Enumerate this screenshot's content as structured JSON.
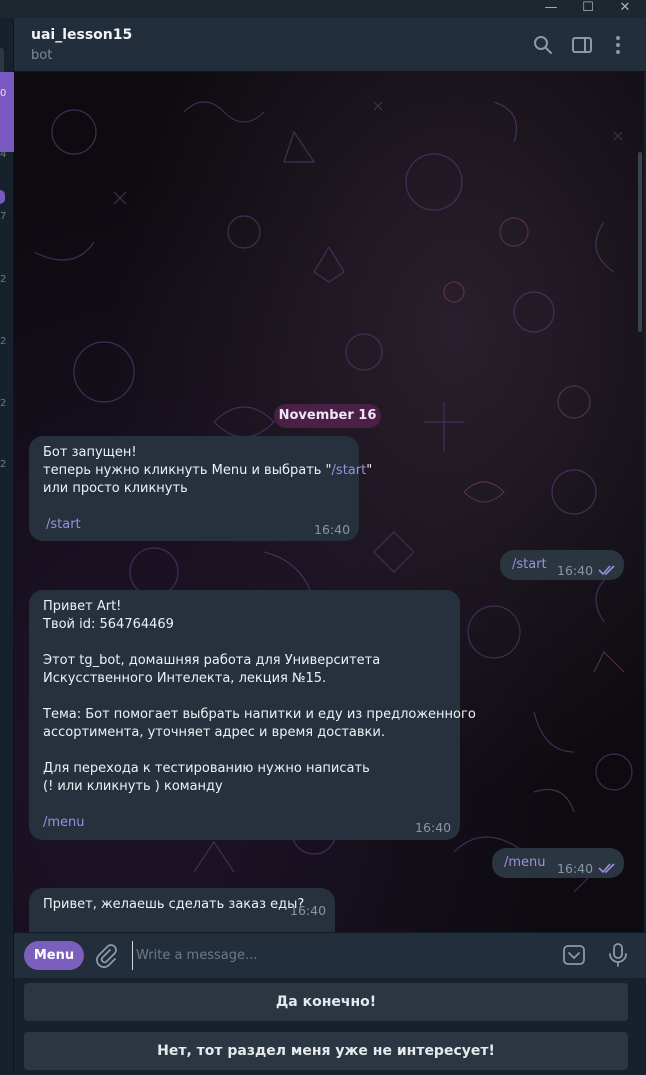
{
  "window": {
    "controls": [
      "—",
      "☐",
      "✕"
    ]
  },
  "chatlist_sliver": {
    "counts": [
      "0",
      "4",
      "7",
      "2",
      "2",
      "2",
      "2"
    ]
  },
  "header": {
    "title": "uai_lesson15",
    "subtitle": "bot",
    "icons": [
      "search-icon",
      "sidebar-toggle-icon",
      "more-vertical-icon"
    ]
  },
  "date_separator": "November 16",
  "messages": [
    {
      "direction": "incoming",
      "lines": [
        "Бот запущен!",
        "теперь нужно кликнуть Menu и выбрать \"",
        "/start",
        "\"",
        "или просто кликнуть"
      ],
      "line1": "Бот запущен!",
      "line2_prefix": "теперь нужно кликнуть Menu и выбрать \"",
      "line2_cmd": "/start",
      "line2_suffix": "\"",
      "line3": "или просто кликнуть",
      "command": "/start",
      "time": "16:40"
    },
    {
      "direction": "outgoing",
      "text": "/start",
      "time": "16:40",
      "status": "read"
    },
    {
      "direction": "incoming",
      "l1": "Привет Art!",
      "l2": "Твой id: 564764469",
      "l3": "Этот tg_bot, домашняя работа для Университета",
      "l4": "Искусственного Интелекта, лекция №15.",
      "l5": "Тема: Бот помогает выбрать напитки и еду из предложенного",
      "l6": "ассортимента, уточняет адрес и время доставки.",
      "l7": "Для перехода к тестированию нужно написать",
      "l8": "(! или кликнуть  ) команду",
      "command": "/menu",
      "time": "16:40"
    },
    {
      "direction": "outgoing",
      "text": "/menu",
      "time": "16:40",
      "status": "read"
    },
    {
      "direction": "incoming",
      "text": "Привет, желаешь сделать заказ еды?",
      "time": "16:40"
    }
  ],
  "composer": {
    "menu_label": "Menu",
    "placeholder": "Write a message...",
    "icons": [
      "attach-icon",
      "bot-keyboard-icon",
      "microphone-icon"
    ]
  },
  "keyboard": {
    "buttons": [
      "Да конечно!",
      "Нет, тот раздел меня уже не интересует!"
    ]
  },
  "colors": {
    "accent": "#7b5fbd",
    "bubble": "#26313d",
    "header": "#232e3c",
    "link": "#9d8ee0",
    "date_pill": "#4a2046"
  }
}
